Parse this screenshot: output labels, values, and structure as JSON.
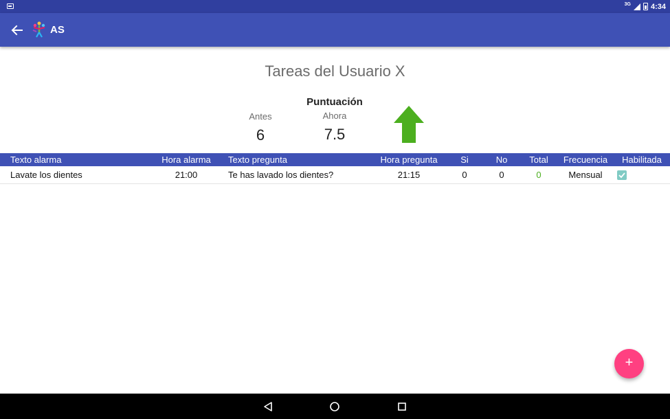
{
  "status_bar": {
    "signal_label": "3G",
    "time": "4:34"
  },
  "app_bar": {
    "title": "AS"
  },
  "page": {
    "title": "Tareas del Usuario X"
  },
  "score": {
    "heading": "Puntuación",
    "before_label": "Antes",
    "before_value": "6",
    "now_label": "Ahora",
    "now_value": "7.5",
    "trend_icon": "arrow-up-icon",
    "trend_color": "#4caf1f"
  },
  "table": {
    "headers": [
      "Texto alarma",
      "Hora alarma",
      "Texto pregunta",
      "Hora pregunta",
      "Si",
      "No",
      "Total",
      "Frecuencia",
      "Habilitada"
    ],
    "rows": [
      {
        "texto_alarma": "Lavate los dientes",
        "hora_alarma": "21:00",
        "texto_pregunta": "Te has lavado los dientes?",
        "hora_pregunta": "21:15",
        "si": "0",
        "no": "0",
        "total": "0",
        "frecuencia": "Mensual",
        "habilitada": true
      }
    ]
  },
  "colors": {
    "primary": "#3f51b5",
    "primary_dark": "#303f9f",
    "accent": "#ff4081",
    "total_color": "#4caf1f",
    "checkbox": "#80cbc4"
  },
  "fab": {
    "label": "+"
  }
}
